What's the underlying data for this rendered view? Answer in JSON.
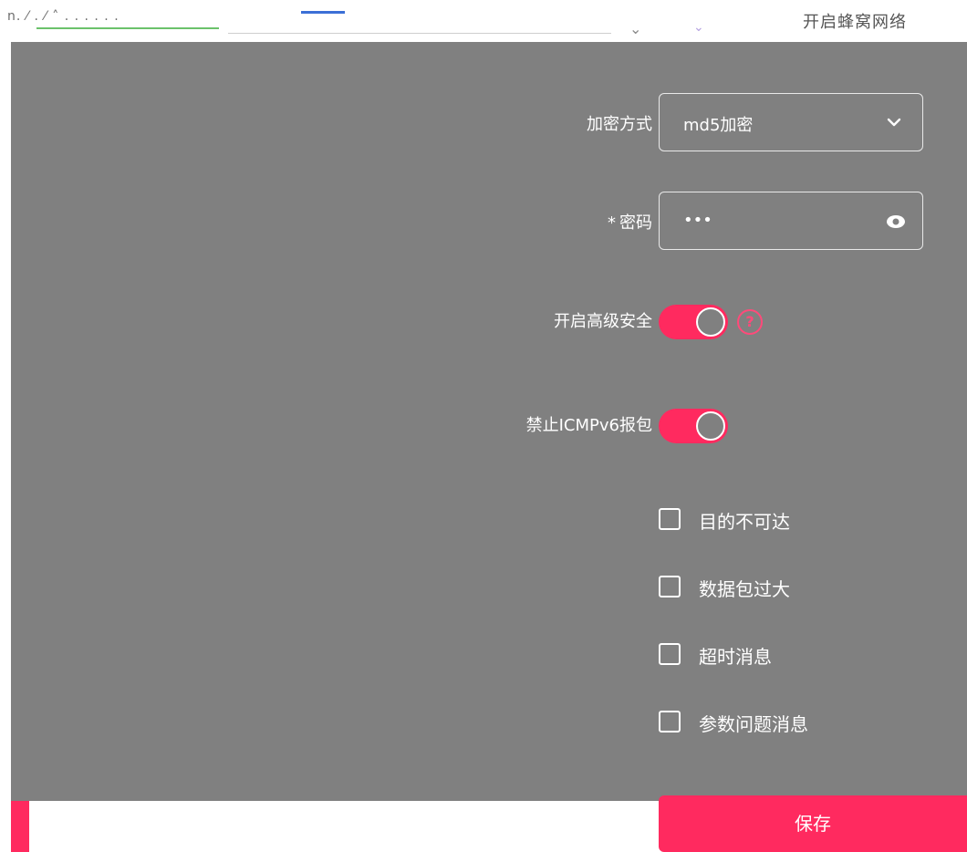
{
  "header": {
    "crumb_text": "n. ⁄ . ⁄ ˄ . . . . . .",
    "title": "开启蜂窝网络"
  },
  "form": {
    "encryption": {
      "label": "加密方式",
      "value": "md5加密"
    },
    "password": {
      "required_mark": "*",
      "label": "密码",
      "value": "•••"
    },
    "advanced_security": {
      "label": "开启高级安全",
      "enabled": true,
      "help_symbol": "?"
    },
    "block_icmpv6": {
      "label": "禁止ICMPv6报包",
      "enabled": true
    },
    "options": [
      {
        "label": "目的不可达",
        "checked": false
      },
      {
        "label": "数据包过大",
        "checked": false
      },
      {
        "label": "超时消息",
        "checked": false
      },
      {
        "label": "参数问题消息",
        "checked": false
      }
    ]
  },
  "footer": {
    "save_label": "保存"
  },
  "colors": {
    "accent": "#ff2a5f",
    "overlay": "#808080"
  }
}
